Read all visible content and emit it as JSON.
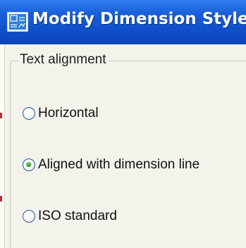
{
  "window": {
    "title": "Modify Dimension Style: S",
    "title_bar_color": "#1a5fd8",
    "icon": "dimension-style-icon"
  },
  "text_alignment": {
    "group_label": "Text alignment",
    "options": [
      {
        "label": "Horizontal",
        "selected": false
      },
      {
        "label": "Aligned with dimension line",
        "selected": true
      },
      {
        "label": "ISO standard",
        "selected": false
      }
    ]
  }
}
